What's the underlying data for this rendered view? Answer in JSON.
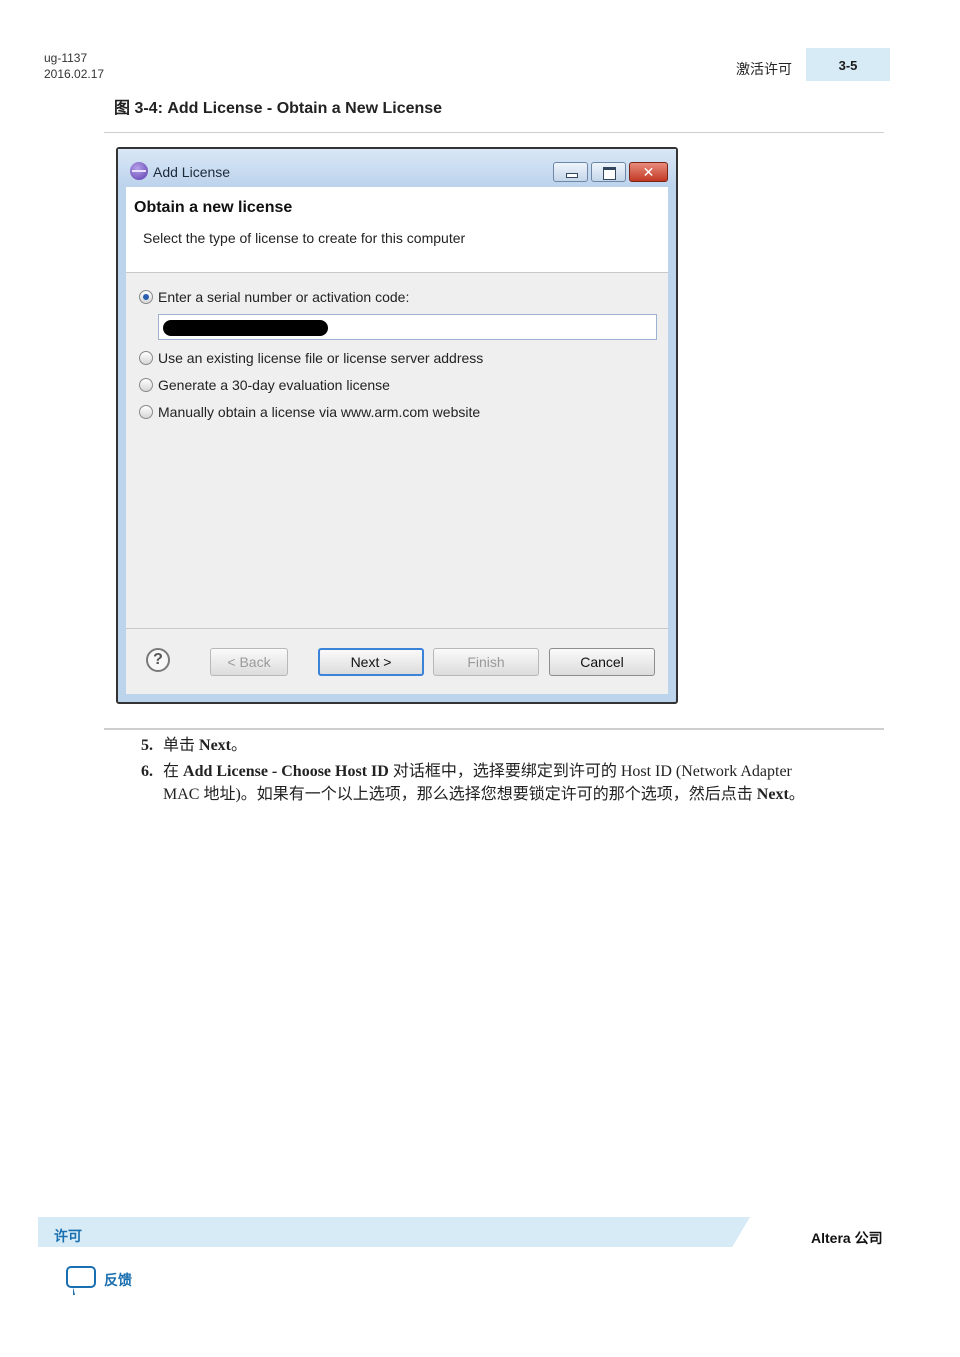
{
  "header": {
    "doc_id": "ug-1137",
    "date": "2016.02.17",
    "section": "激活许可",
    "page": "3-5"
  },
  "figure": {
    "caption": "图 3-4: Add License - Obtain a New License"
  },
  "dialog": {
    "title": "Add License",
    "close_glyph": "✕",
    "heading": "Obtain a new license",
    "subheading": "Select the type of license to create for this computer",
    "options": [
      {
        "label": "Enter a serial number or activation code:",
        "selected": true
      },
      {
        "label": "Use an existing license file or license server address",
        "selected": false
      },
      {
        "label": "Generate a 30-day evaluation license",
        "selected": false
      },
      {
        "label": "Manually obtain a license via www.arm.com website",
        "selected": false
      }
    ],
    "help_glyph": "?",
    "buttons": {
      "back": "< Back",
      "next": "Next >",
      "finish": "Finish",
      "cancel": "Cancel"
    }
  },
  "steps": [
    {
      "num": "5.",
      "pre": "单击 ",
      "bold": "Next",
      "post": "。"
    },
    {
      "num": "6.",
      "pre": "在 ",
      "bold": "Add License - Choose Host ID",
      "mid": " 对话框中，选择要绑定到许可的 Host ID (Network Adapter",
      "line2": "MAC 地址)。如果有一个以上选项，那么选择您想要锁定许可的那个选项，然后点击 ",
      "bold2": "Next",
      "post": "。"
    }
  ],
  "footer": {
    "section": "许可",
    "company": "Altera 公司",
    "feedback": "反馈"
  }
}
